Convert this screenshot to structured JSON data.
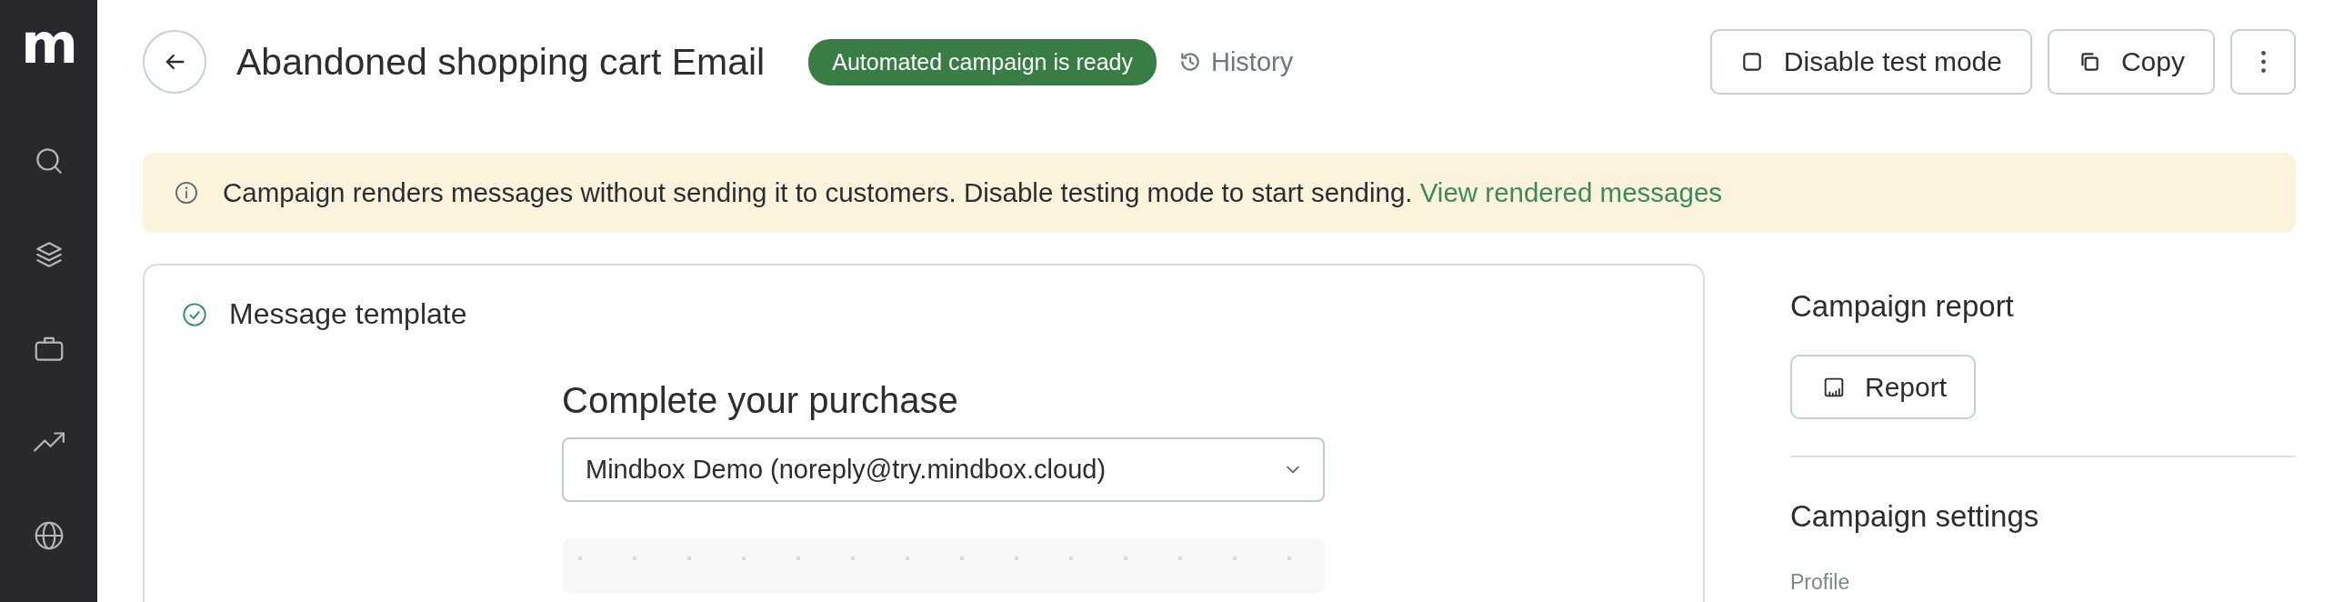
{
  "sidebar": {
    "logo": "m"
  },
  "header": {
    "title": "Abandoned shopping cart Email",
    "status_badge": "Automated campaign is ready",
    "history_link": "History",
    "buttons": [
      {
        "kind": "test-mode",
        "label": "Disable test mode"
      },
      {
        "kind": "copy",
        "label": "Copy"
      },
      {
        "kind": "more"
      }
    ]
  },
  "banner": {
    "text": "Campaign renders messages without sending it to customers. Disable testing mode to start sending.",
    "link": "View rendered messages"
  },
  "template_card": {
    "title": "Message template",
    "completed": true,
    "subject": "Complete your purchase",
    "sender": "Mindbox Demo (noreply@try.mindbox.cloud)"
  },
  "side_panel": {
    "report_heading": "Campaign report",
    "report_button": "Report",
    "settings_heading": "Campaign settings",
    "fields": [
      {
        "label": "Profile"
      }
    ]
  }
}
